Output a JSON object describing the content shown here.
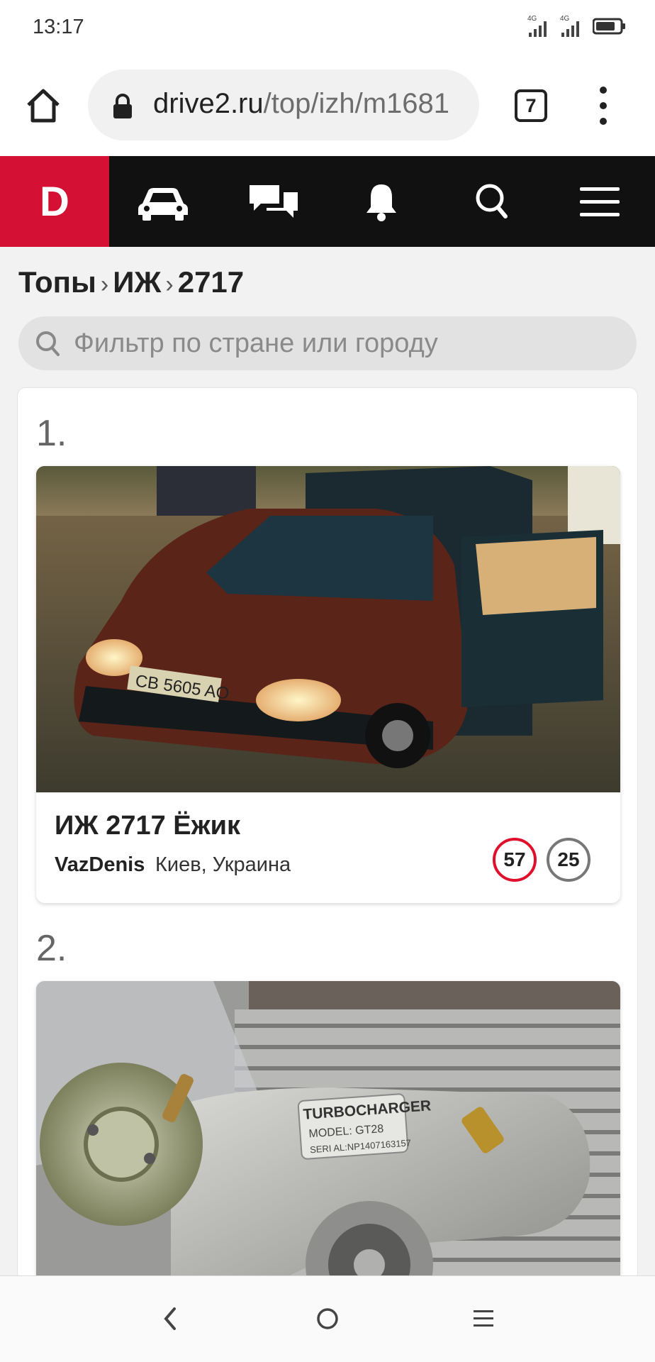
{
  "status_bar": {
    "time": "13:17",
    "network": "4G"
  },
  "browser": {
    "url_domain": "drive2.ru",
    "url_path": "/top/izh/m1681",
    "tab_count": "7"
  },
  "site": {
    "logo": "D"
  },
  "breadcrumb": {
    "items": [
      "Топы",
      "ИЖ",
      "2717"
    ],
    "separator": "›"
  },
  "filter": {
    "placeholder": "Фильтр по стране или городу"
  },
  "cars": [
    {
      "rank": "1.",
      "title": "ИЖ 2717 Ёжик",
      "owner": "VazDenis",
      "location": "Киев, Украина",
      "badge_red": "57",
      "badge_grey": "25",
      "plate": "CB 5605 AO"
    },
    {
      "rank": "2.",
      "turbo_label": "TURBOCHARGER",
      "turbo_model": "MODEL: GT28",
      "turbo_serial": "SERI AL:NP1407163157"
    }
  ],
  "colors": {
    "brand": "#d41034",
    "nav_bg": "#111111",
    "badge_red": "#e0102c"
  }
}
